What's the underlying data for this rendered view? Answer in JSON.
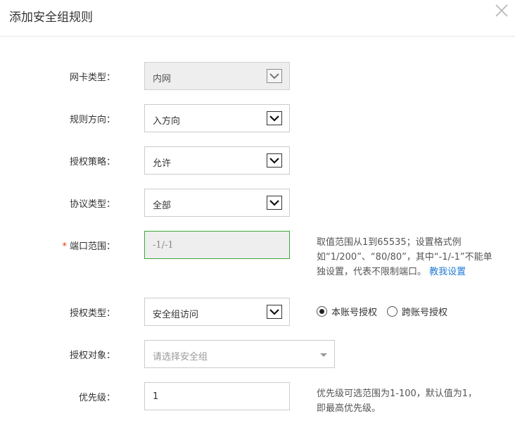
{
  "dialog": {
    "title": "添加安全组规则"
  },
  "fields": {
    "nic_type": {
      "label": "网卡类型：",
      "value": "内网"
    },
    "direction": {
      "label": "规则方向：",
      "value": "入方向"
    },
    "policy": {
      "label": "授权策略：",
      "value": "允许"
    },
    "protocol": {
      "label": "协议类型：",
      "value": "全部"
    },
    "port_range": {
      "required_mark": "*",
      "label": "端口范围：",
      "value": "-1/-1",
      "help_line1": "取值范围从1到65535；设置格式例",
      "help_line2": "如“1/200”、“80/80”，其中“-1/-1”不能单",
      "help_line3": "独设置，代表不限制端口。",
      "help_link": "教我设置"
    },
    "auth_type": {
      "label": "授权类型：",
      "value": "安全组访问",
      "radio_options": [
        {
          "label": "本账号授权",
          "checked": true
        },
        {
          "label": "跨账号授权",
          "checked": false
        }
      ]
    },
    "auth_object": {
      "label": "授权对象：",
      "placeholder": "请选择安全组"
    },
    "priority": {
      "label": "优先级：",
      "value": "1",
      "help_line1": "优先级可选范围为1-100，默认值为1，",
      "help_line2": "即最高优先级。"
    }
  },
  "icons": {
    "close": "close-icon",
    "dropdown": "chevron-down-icon",
    "caret": "caret-down-icon"
  }
}
